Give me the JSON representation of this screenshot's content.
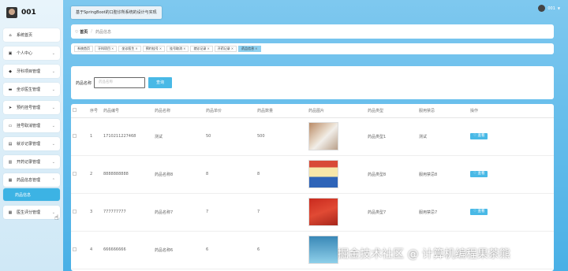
{
  "brand": {
    "title": "001"
  },
  "header": {
    "system_title": "基于SpringBoot的口腔诊所系统的设计与实现",
    "username": "001"
  },
  "sidebar": {
    "items": [
      {
        "label": "系统首页",
        "icon": "home-icon",
        "glyph": "⌂",
        "chevron": ""
      },
      {
        "label": "个人中心",
        "icon": "calendar-icon",
        "glyph": "▣",
        "chevron": "⌄"
      },
      {
        "label": "牙科项目管理",
        "icon": "tag-icon",
        "glyph": "◆",
        "chevron": "⌄"
      },
      {
        "label": "坐诊医生管理",
        "icon": "briefcase-icon",
        "glyph": "▬",
        "chevron": "⌄"
      },
      {
        "label": "预约挂号管理",
        "icon": "send-icon",
        "glyph": "➤",
        "chevron": "⌄"
      },
      {
        "label": "挂号取消管理",
        "icon": "monitor-icon",
        "glyph": "▭",
        "chevron": "⌄"
      },
      {
        "label": "就诊记录管理",
        "icon": "clipboard-icon",
        "glyph": "▤",
        "chevron": "⌄"
      },
      {
        "label": "开药记录管理",
        "icon": "file-icon",
        "glyph": "▥",
        "chevron": "⌄"
      },
      {
        "label": "药品信息管理",
        "icon": "grid-icon",
        "glyph": "▦",
        "chevron": "⌃"
      },
      {
        "label": "药品信息",
        "icon": "",
        "glyph": "",
        "chevron": ""
      },
      {
        "label": "医生评分管理",
        "icon": "grid-icon",
        "glyph": "▦",
        "chevron": "⌄"
      }
    ]
  },
  "breadcrumb": {
    "home": "首页",
    "current": "药品信息"
  },
  "tabs": [
    "系统首页",
    "牙科项目",
    "坐诊医生",
    "预约挂号",
    "挂号取消",
    "就诊记录",
    "开药记录",
    "药品信息"
  ],
  "search": {
    "label": "药品名称",
    "placeholder": "药品名称",
    "button": "查询"
  },
  "table": {
    "headers": [
      "",
      "序号",
      "药品编号",
      "药品名称",
      "药品单价",
      "药品数量",
      "药品图片",
      "药品类型",
      "服用禁忌",
      "操作"
    ],
    "rows": [
      {
        "index": "1",
        "code": "1710211227468",
        "name": "测试",
        "price": "50",
        "qty": "500",
        "type": "药品类型1",
        "taboo": "测试",
        "action": "♡ 查看"
      },
      {
        "index": "2",
        "code": "8888888888",
        "name": "药品名称8",
        "price": "8",
        "qty": "8",
        "type": "药品类型8",
        "taboo": "服用禁忌8",
        "action": "♡ 查看"
      },
      {
        "index": "3",
        "code": "777777777",
        "name": "药品名称7",
        "price": "7",
        "qty": "7",
        "type": "药品类型7",
        "taboo": "服用禁忌7",
        "action": "♡ 查看"
      },
      {
        "index": "4",
        "code": "666666666",
        "name": "药品名称6",
        "price": "6",
        "qty": "6",
        "type": "",
        "taboo": "",
        "action": ""
      }
    ]
  },
  "watermark": "掘金技术社区 @ 计算机编程果茶熊"
}
